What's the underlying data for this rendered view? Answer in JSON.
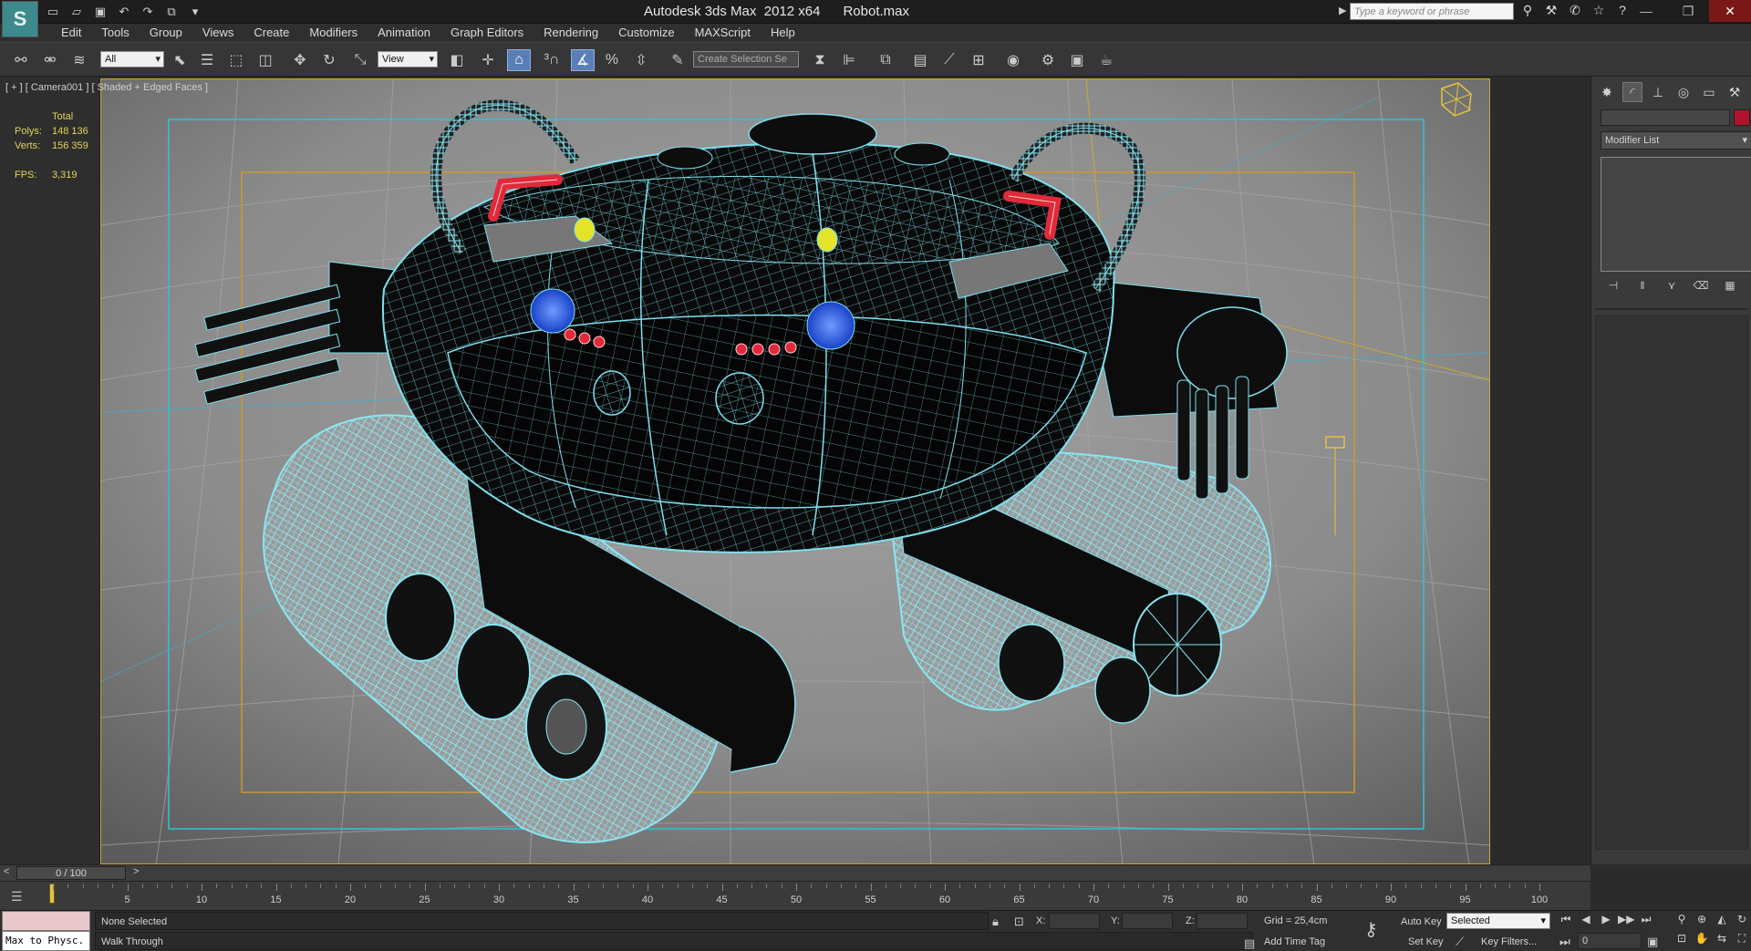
{
  "window": {
    "title": "Autodesk 3ds Max  2012 x64      Robot.max",
    "search_placeholder": "Type a keyword or phrase",
    "logo_letter": "S"
  },
  "menu": [
    "Edit",
    "Tools",
    "Group",
    "Views",
    "Create",
    "Modifiers",
    "Animation",
    "Graph Editors",
    "Rendering",
    "Customize",
    "MAXScript",
    "Help"
  ],
  "toolbar": {
    "selection_filter": "All",
    "reference_coord": "View",
    "named_selection_placeholder": "Create Selection Se"
  },
  "viewport": {
    "label": "[ + ] [ Camera001 ] [ Shaded + Edged Faces ]",
    "stats": {
      "header": "Total",
      "polys_label": "Polys:",
      "polys_value": "148 136",
      "verts_label": "Verts:",
      "verts_value": "156 359",
      "fps_label": "FPS:",
      "fps_value": "3,319"
    },
    "colors": {
      "background_center": "#9a9a9a",
      "wire": "#7fdfee",
      "mesh_fill": "#0c0c0c",
      "safe_frame_cyan": "#2ec3d8",
      "safe_frame_orange": "#c99a2e",
      "red_pipe": "#e02a3a",
      "blue_light": "#2a63e8",
      "yellow_bulb": "#e3e32a"
    }
  },
  "command_panel": {
    "modifier_list": "Modifier List",
    "object_color": "#b3122d"
  },
  "timeline": {
    "frame_display": "0 / 100",
    "ticks": [
      "5",
      "10",
      "15",
      "20",
      "25",
      "30",
      "35",
      "40",
      "45",
      "50",
      "55",
      "60",
      "65",
      "70",
      "75",
      "80",
      "85",
      "90",
      "95",
      "100"
    ]
  },
  "status": {
    "selection": "None Selected",
    "prompt": "Walk Through",
    "maxscript_text": "Max to Physc.",
    "x_label": "X:",
    "y_label": "Y:",
    "z_label": "Z:",
    "grid": "Grid = 25,4cm",
    "add_time_tag": "Add Time Tag",
    "auto_key": "Auto Key",
    "set_key": "Set Key",
    "key_mode": "Selected",
    "key_filters": "Key Filters...",
    "current_frame": "0"
  }
}
